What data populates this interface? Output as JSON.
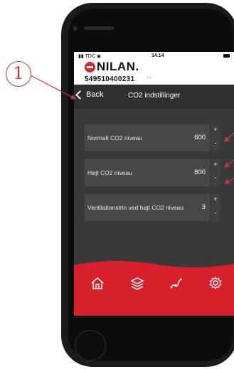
{
  "callout": {
    "number": "1"
  },
  "status": {
    "carrier": "TDC",
    "time": "14.14"
  },
  "brand": {
    "name": "NILAN",
    "serial": "549510400231"
  },
  "nav": {
    "back_label": "Back",
    "title": "CO2 indstillinger"
  },
  "settings": [
    {
      "label": "Normalt CO2 niveau",
      "value": "600",
      "plus": "+",
      "minus": "-"
    },
    {
      "label": "Højt CO2 niveau",
      "value": "800",
      "plus": "+",
      "minus": "-"
    },
    {
      "label": "Ventilationstrin ved højt CO2 niveau",
      "value": "3",
      "plus": "+",
      "minus": "-"
    }
  ],
  "tabs": [
    {
      "icon": "home-icon"
    },
    {
      "icon": "layers-icon"
    },
    {
      "icon": "graph-icon"
    },
    {
      "icon": "gear-icon"
    }
  ],
  "colors": {
    "accent_red": "#d81f2c",
    "callout_red": "#c43a3a",
    "screen_bg": "#393939",
    "row_bg": "#474747"
  }
}
